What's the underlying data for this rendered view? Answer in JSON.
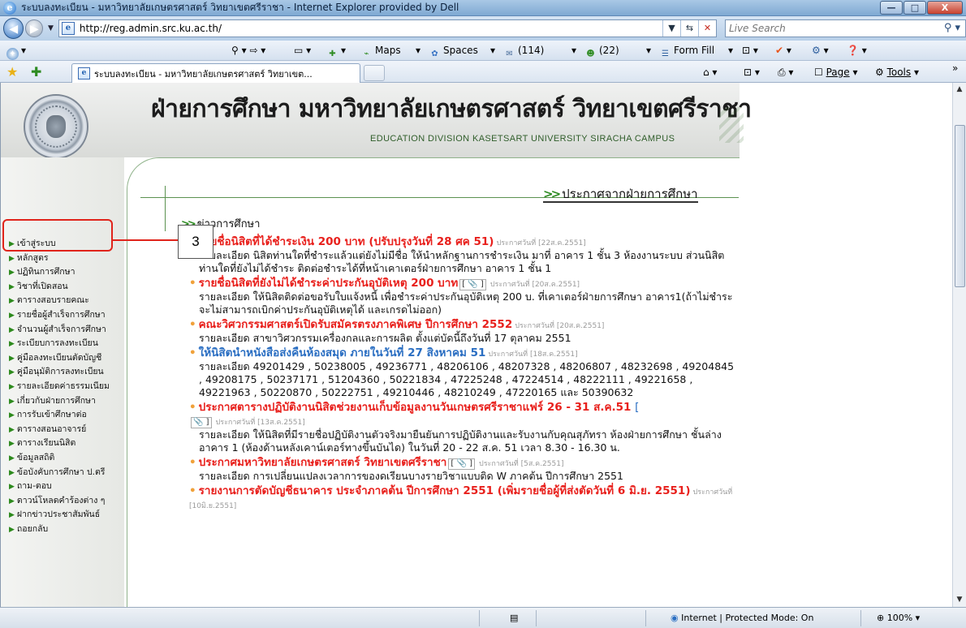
{
  "window": {
    "title": "ระบบลงทะเบียน - มหาวิทยาลัยเกษตรศาสตร์ วิทยาเขตศรีราชา - Internet Explorer provided by Dell",
    "minimize": "—",
    "maximize": "□",
    "close": "X"
  },
  "address": {
    "url": "http://reg.admin.src.ku.ac.th/",
    "search_placeholder": "Live Search"
  },
  "toolbar": {
    "maps": "Maps",
    "spaces": "Spaces",
    "mail_count": "(114)",
    "contacts_count": "(22)",
    "form_fill": "Form Fill"
  },
  "favbar": {
    "tab_title": "ระบบลงทะเบียน - มหาวิทยาลัยเกษตรศาสตร์ วิทยาเขต...",
    "page_menu": "Page",
    "tools_menu": "Tools",
    "chevron": "»"
  },
  "site": {
    "title": "ฝ่ายการศึกษา มหาวิทยาลัยเกษตรศาสตร์ วิทยาเขตศรีราชา",
    "subtitle": "EDUCATION DIVISION  KASETSART UNIVERSITY SIRACHA CAMPUS",
    "announce_heading": "ประกาศจากฝ่ายการศึกษา",
    "news_heading": "ข่าวการศึกษา"
  },
  "annotation": {
    "callout_number": "3"
  },
  "sidebar": {
    "items": [
      "เข้าสู่ระบบ",
      "หลักสูตร",
      "ปฏิทินการศึกษา",
      "วิชาที่เปิดสอน",
      "ตารางสอบรายคณะ",
      "รายชื่อผู้สำเร็จการศึกษา",
      "จำนวนผู้สำเร็จการศึกษา",
      "ระเบียบการลงทะเบียน",
      "คู่มือลงทะเบียนตัดบัญชี",
      "คู่มือนุมัติการลงทะเบียน",
      "รายละเอียดค่าธรรมเนียม",
      "เกี่ยวกับฝ่ายการศึกษา",
      "การรับเข้าศึกษาต่อ",
      "ตารางสอนอาจารย์",
      "ตารางเรียนนิสิต",
      "ข้อมูลสถิติ",
      "ข้อบังคับการศึกษา ป.ตรี",
      "ถาม-ตอบ",
      "ดาวน์โหลดคำร้องต่าง ๆ",
      "ฝากข่าวประชาสัมพันธ์",
      "ถอยกลับ"
    ]
  },
  "news": [
    {
      "title": "รายชื่อนิสิตที่ได้ชำระเงิน 200 บาท (ปรับปรุงวันที่ 28 ศค 51)",
      "date": "ประกาศวันที่ [22ส.ค.2551]",
      "desc": "รายละเอียด นิสิตท่านใดที่ชำระแล้วแต่ยังไม่มีชื่อ ให้นำหลักฐานการชำระเงิน มาที่ อาคาร 1 ชั้น 3 ห้องงานระบบ ส่วนนิสิตท่านใดที่ยังไม่ได้ชำระ ติดต่อชำระได้ที่หน้าเคาเตอร์ฝ่ายการศึกษา อาคาร 1 ชั้น 1"
    },
    {
      "title": "รายชื่อนิสิตที่ยังไม่ได้ชำระค่าประกันอุบัติเหตุ 200 บาท",
      "clip": "[ 📎 ]",
      "date": "ประกาศวันที่ [20ส.ค.2551]",
      "desc": "รายละเอียด ให้นิสิตติดต่อขอรับใบแจ้งหนี้ เพื่อชำระค่าประกันอุบัติเหตุ 200 บ. ที่เคาเตอร์ฝ่ายการศึกษา อาคาร1(ถ้าไม่ชำระจะไม่สามารถเบิกค่าประกันอุบัติเหตุได้ และเกรดไม่ออก)"
    },
    {
      "title": "คณะวิศวกรรมศาสตร์เปิดรับสมัครตรงภาคพิเศษ ปีการศึกษา 2552",
      "date": "ประกาศวันที่ [20ส.ค.2551]",
      "desc": "รายละเอียด สาขาวิศวกรรมเครื่องกลและการผลิต ตั้งแต่บัดนี้ถึงวันที่ 17 ตุลาคม 2551"
    },
    {
      "title": "ให้นิสิตนำหนังสือส่งคืนห้องสมุด ภายในวันที่ 27 สิงหาคม 51",
      "date": "ประกาศวันที่ [18ส.ค.2551]",
      "desc": "รายละเอียด 49201429 , 50238005 , 49236771 , 48206106 , 48207328 , 48206807 , 48232698 , 49204845 , 49208175 , 50237171 , 51204360 , 50221834 , 47225248 , 47224514 , 48222111 , 49221658 , 49221963 , 50220870 , 50222751 , 49210446 , 48210249 , 47220165 และ 50390632"
    },
    {
      "title": "ประกาศตารางปฏิบัติงานนิสิตช่วยงานเก็บข้อมูลงานวันเกษตรศรีราชาแฟร์ 26 - 31 ส.ค.51",
      "brk_open": "[",
      "clip": "📎 ]",
      "date": "ประกาศวันที่ [13ส.ค.2551]",
      "desc": "รายละเอียด ให้นิสิตที่มีรายชื่อปฏิบัติงานตัวจริงมายืนยันการปฏิบัติงานและรับงานกับคุณสุภัทรา ห้องฝ่ายการศึกษา ชั้นล่าง อาคาร 1 (ห้องด้านหลังเคาน์เตอร์ทางขึ้นบันได) ในวันที่ 20 - 22 ส.ค. 51 เวลา 8.30 - 16.30 น."
    },
    {
      "title": "ประกาศมหาวิทยาลัยเกษตรศาสตร์ วิทยาเขตศรีราชา",
      "clip": "[ 📎 ]",
      "date": "ประกาศวันที่ [5ส.ค.2551]",
      "desc": "รายละเอียด การเปลี่ยนแปลงเวลาการของดเรียนบางรายวิชาแบบติด W ภาคต้น ปีการศึกษา 2551"
    },
    {
      "title": "รายงานการตัดบัญชีธนาคาร ประจำภาคต้น ปีการศึกษา 2551 (เพิ่มรายชื่อผู้ที่ส่งตัดวันที่ 6 มิ.ย. 2551)",
      "date": "ประกาศวันที่ [10มิ.ย.2551]",
      "desc": ""
    }
  ],
  "status": {
    "zone": "Internet | Protected Mode: On",
    "zoom": "100%"
  },
  "colors": {
    "accent_green": "#2e8b22",
    "news_red": "#e8201c",
    "news_blue": "#2a6ec2",
    "annotation_red": "#e0241b"
  }
}
